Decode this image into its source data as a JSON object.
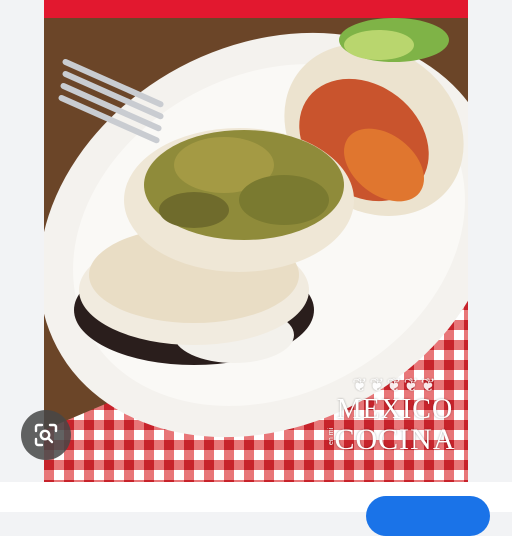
{
  "image": {
    "alt": "Gorditas on a white plate with checkered tablecloth",
    "watermark": {
      "line1": "MEXICO",
      "line2": "COCINA",
      "small": "en mi",
      "ornament": "❦❦❦❦❦"
    }
  },
  "lens": {
    "icon": "lens-icon"
  },
  "bottom": {
    "caption": "",
    "action_label": ""
  },
  "colors": {
    "accent_red": "#e2182f",
    "button_blue": "#1a73e8"
  }
}
